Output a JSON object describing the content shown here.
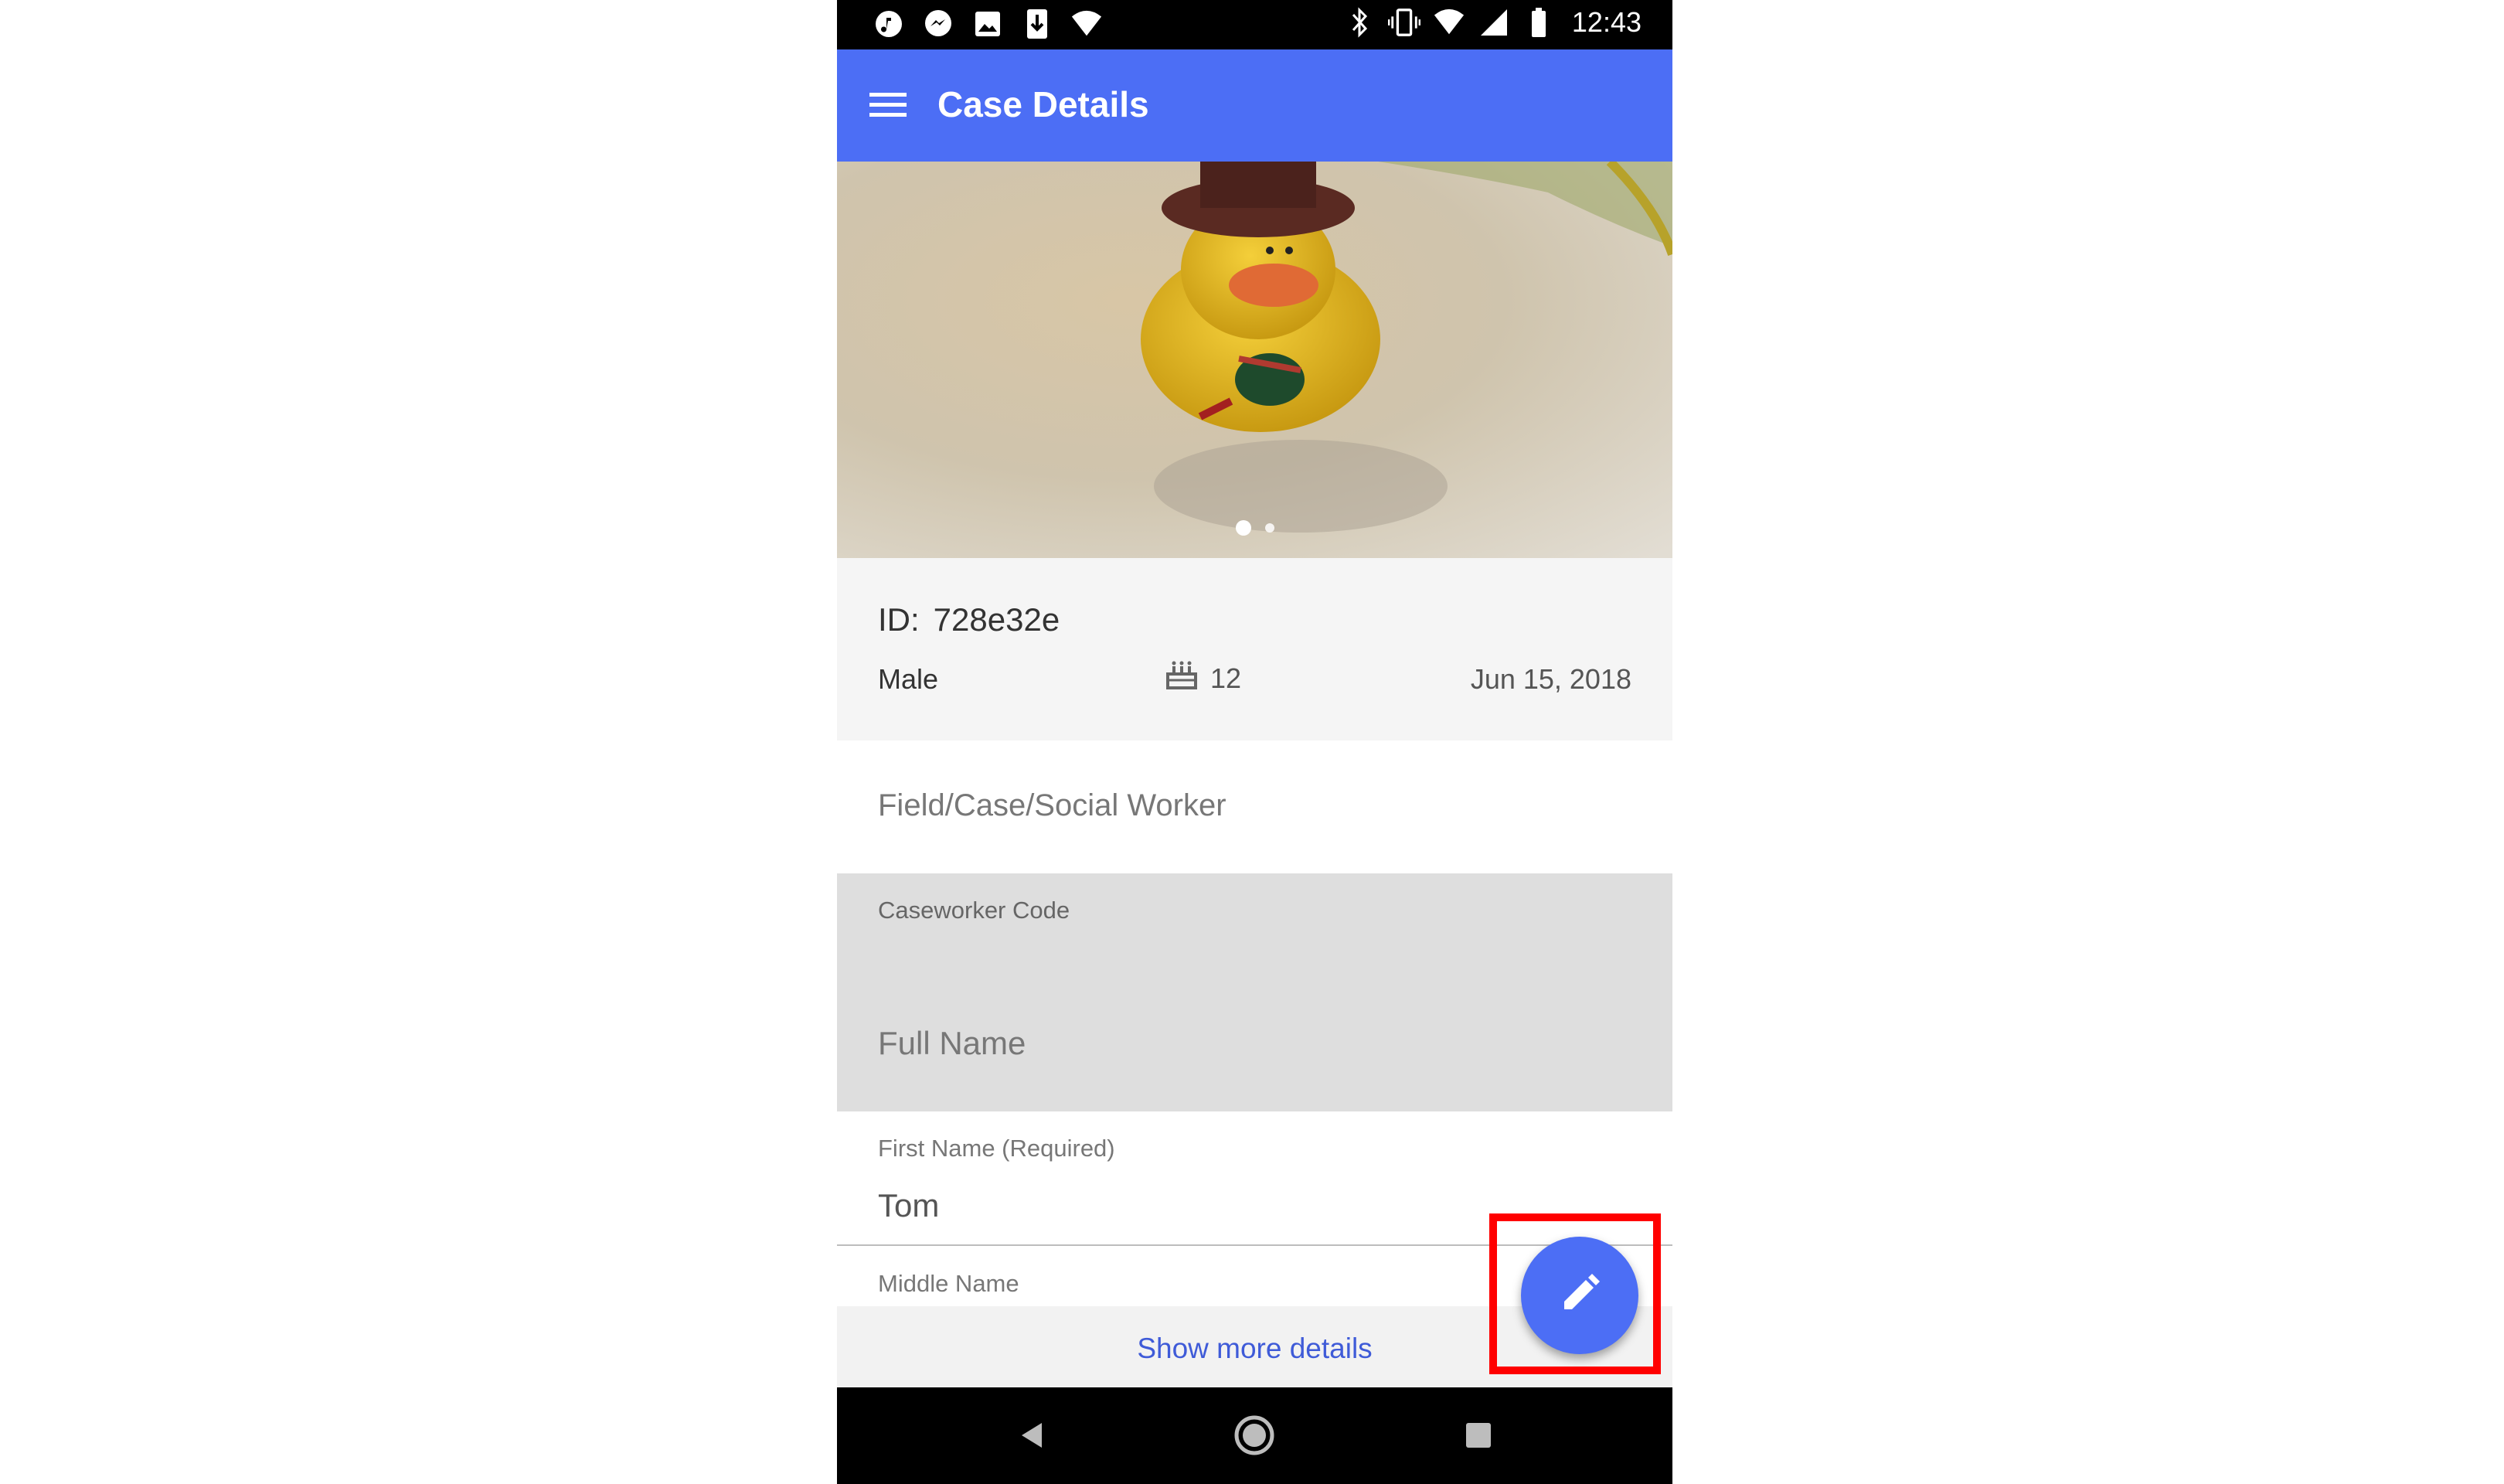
{
  "status_bar": {
    "time": "12:43",
    "left_icons": [
      "music-icon",
      "messenger-icon",
      "image-icon",
      "download-icon",
      "wifi-icon"
    ],
    "right_icons": [
      "bluetooth-icon",
      "vibrate-icon",
      "wifi-icon",
      "signal-icon",
      "battery-icon"
    ]
  },
  "toolbar": {
    "title": "Case Details",
    "menu_icon": "hamburger-menu-icon"
  },
  "photo": {
    "description_icon": "photo-carousel",
    "pages": 2,
    "current_page": 1
  },
  "summary": {
    "id_label": "ID:",
    "id_value": "728e32e",
    "gender": "Male",
    "age": "12",
    "age_icon": "birthday-cake-icon",
    "date": "Jun 15, 2018"
  },
  "section": {
    "title": "Field/Case/Social Worker"
  },
  "caseworker": {
    "label": "Caseworker Code",
    "full_name_placeholder": "Full Name"
  },
  "first_name": {
    "label": "First Name (Required)",
    "value": "Tom"
  },
  "middle_name": {
    "label": "Middle Name"
  },
  "show_more": {
    "label": "Show more details"
  },
  "fab": {
    "icon": "edit-pencil-icon"
  },
  "colors": {
    "accent": "#4C6EF5",
    "highlight": "#FF0000",
    "link": "#3F5BD8"
  }
}
